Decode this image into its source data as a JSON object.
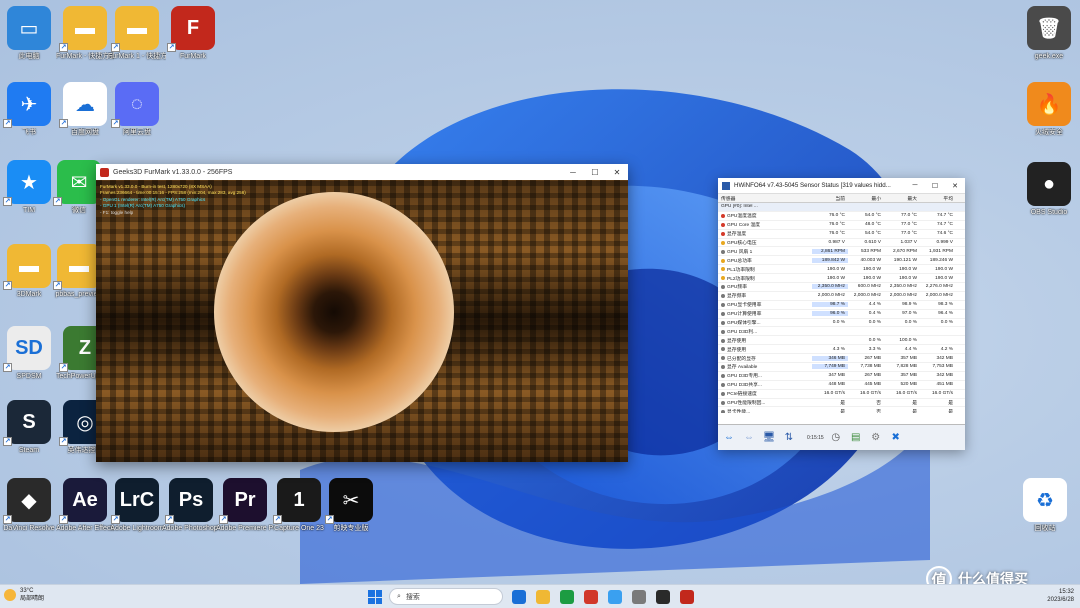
{
  "desktop": {
    "icons": [
      {
        "label": "此电脑",
        "color": "#2f86d9",
        "glyph": "▭"
      },
      {
        "label": "FurMark - 快捷方式",
        "color": "#f0b834",
        "glyph": "▬"
      },
      {
        "label": "FurMark 1 - 快捷方式",
        "color": "#f0b834",
        "glyph": "▬"
      },
      {
        "label": "FurMark",
        "color": "#c2281c",
        "glyph": "F"
      },
      {
        "label": "飞书",
        "color": "#1f7bf2",
        "glyph": "✈"
      },
      {
        "label": "百度网盘",
        "color": "#ffffff",
        "glyph": "☁"
      },
      {
        "label": "阿里云盘",
        "color": "#5a6cf5",
        "glyph": "◌"
      },
      {
        "label": "TIM",
        "color": "#1a8df5",
        "glyph": "★"
      },
      {
        "label": "微信",
        "color": "#2bbd4b",
        "glyph": "✉"
      },
      {
        "label": "3DMark",
        "color": "#f0b834",
        "glyph": "▬"
      },
      {
        "label": "pbbas_preview",
        "color": "#f0b834",
        "glyph": "▬"
      },
      {
        "label": "SPDSM",
        "color": "#ececec",
        "glyph": "SD"
      },
      {
        "label": "TechPowerUp GPU-Z",
        "color": "#3b7a31",
        "glyph": "Z"
      },
      {
        "label": "Steam",
        "color": "#1b2838",
        "glyph": "S"
      },
      {
        "label": "英伟达控制",
        "color": "#0b2340",
        "glyph": "◎"
      },
      {
        "label": "DaVinci Resolve",
        "color": "#2a2a2a",
        "glyph": "◆"
      },
      {
        "label": "Adobe After Effects 2022",
        "color": "#1a1a3a",
        "glyph": "Ae"
      },
      {
        "label": "Adobe Lightroom",
        "color": "#0f1e2e",
        "glyph": "LrC"
      },
      {
        "label": "Adobe Photoshop 2022",
        "color": "#0f1e2e",
        "glyph": "Ps"
      },
      {
        "label": "Adobe Premiere Pro 2022",
        "color": "#1d0f2e",
        "glyph": "Pr"
      },
      {
        "label": "Capture One 23",
        "color": "#1a1a1a",
        "glyph": "1"
      },
      {
        "label": "剪映专业版",
        "color": "#0c0c0c",
        "glyph": "✂"
      },
      {
        "label": "geek.exe",
        "color": "#4a4a4a",
        "glyph": "🗑"
      },
      {
        "label": "火绒安全",
        "color": "#f08a1c",
        "glyph": "🔥"
      },
      {
        "label": "OBS Studio",
        "color": "#222222",
        "glyph": "●"
      },
      {
        "label": "回收站",
        "color": "#ffffff",
        "glyph": "♻"
      }
    ]
  },
  "furmark": {
    "title": "Geeks3D FurMark v1.33.0.0 - 256FPS",
    "osd": [
      "FurMark v1.33.0.0 - Burn-in test, 1280x720 (8X MSAA)",
      "Frames:236664 - time:00:15:16 - FPS:258 (min:204, max:283, avg:256)",
      "- OpenGL renderer: Intel(R) Arc(TM) A750 Graphics",
      "- GPU 1 (Intel(R) Arc(TM) A750 Graphics)",
      "- F1: toggle help"
    ]
  },
  "hwinfo": {
    "title": "HWiNFO64 v7.43-5045 Sensor Status [319 values hidd...",
    "columns": [
      "传感器",
      "当前",
      "最小",
      "最大",
      "平均"
    ],
    "rows": [
      {
        "name": "GPU [#0]: Intel ...",
        "v": [
          "",
          "",
          "",
          ""
        ],
        "grp": true
      },
      {
        "name": "GPU温度温度",
        "v": [
          "76.0 °C",
          "54.0 °C",
          "77.0 °C",
          "74.7 °C"
        ],
        "dot": "#d43a2a"
      },
      {
        "name": "GPU Core 温度",
        "v": [
          "76.0 °C",
          "48.0 °C",
          "77.0 °C",
          "74.7 °C"
        ],
        "dot": "#d43a2a"
      },
      {
        "name": "显存温度",
        "v": [
          "76.0 °C",
          "54.0 °C",
          "77.0 °C",
          "74.6 °C"
        ],
        "dot": "#d43a2a"
      },
      {
        "name": "GPU核心电压",
        "v": [
          "0.987 V",
          "0.610 V",
          "1.037 V",
          "0.999 V"
        ],
        "dot": "#e8a820"
      },
      {
        "name": "GPU 风扇 1",
        "v": [
          "2,861 RPM",
          "533 RPM",
          "2,670 RPM",
          "1,931 RPM"
        ],
        "dot": "#777",
        "hl": true
      },
      {
        "name": "GPU总功率",
        "v": [
          "189.842 W",
          "40.003 W",
          "190.121 W",
          "189.246 W"
        ],
        "dot": "#e8a820",
        "hl": true
      },
      {
        "name": "PL1功率限制",
        "v": [
          "190.0 W",
          "190.0 W",
          "190.0 W",
          "190.0 W"
        ],
        "dot": "#e8a820"
      },
      {
        "name": "PL2功率限制",
        "v": [
          "190.0 W",
          "190.0 W",
          "190.0 W",
          "190.0 W"
        ],
        "dot": "#e8a820"
      },
      {
        "name": "GPU频率",
        "v": [
          "2,350.0 MHz",
          "600.0 MHz",
          "2,350.0 MHz",
          "2,276.0 MHz"
        ],
        "dot": "#777",
        "hl": true
      },
      {
        "name": "显存频率",
        "v": [
          "2,000.0 MHz",
          "2,000.0 MHz",
          "2,000.0 MHz",
          "2,000.0 MHz"
        ],
        "dot": "#777"
      },
      {
        "name": "GPU显卡使用率",
        "v": [
          "98.7 %",
          "4.4 %",
          "98.9 %",
          "98.3 %"
        ],
        "dot": "#777",
        "hl": true
      },
      {
        "name": "GPU计算使用率",
        "v": [
          "96.0 %",
          "0.4 %",
          "97.0 %",
          "96.4 %"
        ],
        "dot": "#777",
        "hl": true
      },
      {
        "name": "GPU媒体引擎...",
        "v": [
          "0.0 %",
          "0.0 %",
          "0.0 %",
          "0.0 %"
        ],
        "dot": "#777"
      },
      {
        "name": "GPU D3D利...",
        "v": [
          "",
          "",
          "",
          ""
        ],
        "dot": "#777"
      },
      {
        "name": "显存使用",
        "v": [
          "",
          "0.0 %",
          "100.0 %",
          ""
        ],
        "dot": "#777"
      },
      {
        "name": "显存使用",
        "v": [
          "4.3 %",
          "3.3 %",
          "4.4 %",
          "4.2 %"
        ],
        "dot": "#777"
      },
      {
        "name": "已分配的显存",
        "v": [
          "346 MB",
          "267 MB",
          "357 MB",
          "342 MB"
        ],
        "dot": "#777",
        "hl": true
      },
      {
        "name": "显存 Available",
        "v": [
          "7,749 MB",
          "7,738 MB",
          "7,828 MB",
          "7,753 MB"
        ],
        "dot": "#777",
        "hl": true
      },
      {
        "name": "GPU D3D专用...",
        "v": [
          "347 MB",
          "267 MB",
          "357 MB",
          "342 MB"
        ],
        "dot": "#777"
      },
      {
        "name": "GPU D3D共享...",
        "v": [
          "448 MB",
          "445 MB",
          "520 MB",
          "451 MB"
        ],
        "dot": "#777"
      },
      {
        "name": "PCIe链接速度",
        "v": [
          "16.0 GT/s",
          "16.0 GT/s",
          "16.0 GT/s",
          "16.0 GT/s"
        ],
        "dot": "#777"
      },
      {
        "name": "GPU性能限制因...",
        "v": [
          "是",
          "否",
          "是",
          "是"
        ],
        "dot": "#777"
      },
      {
        "name": "显卡性能...",
        "v": [
          "是",
          "否",
          "是",
          "是"
        ],
        "dot": "#777"
      }
    ],
    "clock": "0:15:15"
  },
  "taskbar": {
    "weather_temp": "33°C",
    "weather_desc": "局部晴朗",
    "search_placeholder": "搜索",
    "time": "15:32",
    "date": "2023/6/28",
    "apps": [
      "#1a6fd6",
      "#f0b834",
      "#1c9c42",
      "#d1382a",
      "#3aa0f0",
      "#7a7a7a",
      "#2a2a2a",
      "#c2281c"
    ]
  },
  "watermark": {
    "text": "什么值得买",
    "glyph": "值"
  }
}
